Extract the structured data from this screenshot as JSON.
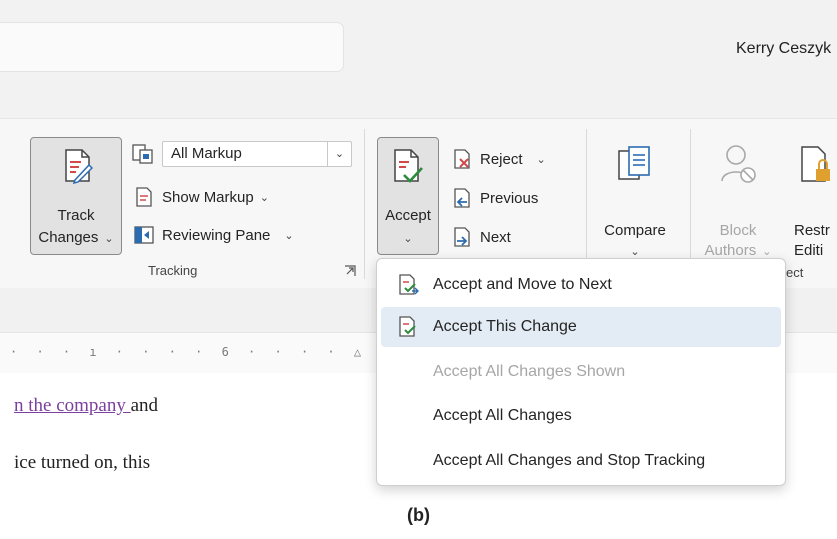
{
  "user": {
    "name": "Kerry Ceszyk"
  },
  "tracking": {
    "track_changes": {
      "line1": "Track",
      "line2": "Changes"
    },
    "markup_select": "All Markup",
    "show_markup": "Show Markup",
    "reviewing_pane": "Reviewing Pane",
    "group_label": "Tracking"
  },
  "changes": {
    "accept": "Accept",
    "reject": "Reject",
    "previous": "Previous",
    "next": "Next"
  },
  "compare": {
    "label": "Compare"
  },
  "protect": {
    "block_line1": "Block",
    "block_line2": "Authors",
    "restrict_line1": "Restr",
    "restrict_line2": "Editi",
    "group_label_partial": "ect"
  },
  "dropdown": {
    "items": [
      {
        "label": "Accept and Move to Next",
        "icon": "accept-move-icon",
        "state": "normal"
      },
      {
        "label": "Accept This Change",
        "icon": "accept-change-icon",
        "state": "highlighted"
      },
      {
        "label": "Accept All Changes Shown",
        "state": "disabled"
      },
      {
        "label": "Accept All Changes",
        "state": "normal"
      },
      {
        "label": "Accept All Changes and Stop Tracking",
        "state": "normal"
      }
    ]
  },
  "ruler": {
    "mark": "6"
  },
  "document": {
    "line1_changed": "n the company ",
    "line1_rest": "and",
    "line2": "ice turned on, this"
  },
  "caption": "(b)",
  "colors": {
    "accent_purple": "#7b3f9e",
    "highlight": "#e3ebf4",
    "disabled_text": "#a6a6a6"
  }
}
